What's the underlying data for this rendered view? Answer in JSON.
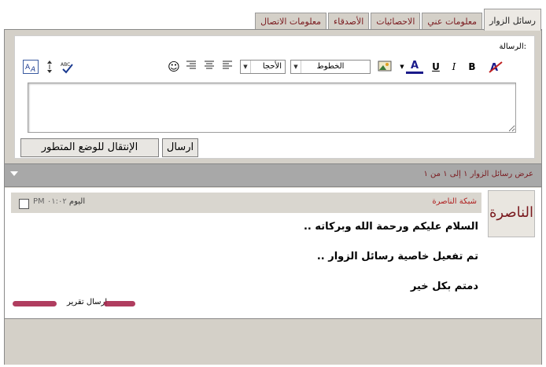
{
  "tabs": [
    {
      "label": "رسائل الزوار",
      "active": true
    },
    {
      "label": "معلومات عني",
      "active": false
    },
    {
      "label": "الاحصائيات",
      "active": false
    },
    {
      "label": "الأصدقاء",
      "active": false
    },
    {
      "label": "معلومات الاتصال",
      "active": false
    }
  ],
  "form": {
    "message_label": "الرسالة:",
    "editor_value": "",
    "toolbar": {
      "remove_format_icon": "remove-format-icon",
      "bold": "B",
      "italic": "I",
      "underline": "U",
      "font_color_letter": "A",
      "font_color": "#1a1a8a",
      "font_family_value": "الخطوط",
      "font_size_value": "الأحجا",
      "smiley": "☺"
    },
    "send_button": "ارسال",
    "advanced_button": "الإنتقال للوضع المتطور"
  },
  "list_header": {
    "text": "عرض رسائل الزوار ١ إلى ١ من ١"
  },
  "entry": {
    "author": "شبكة الناصرة",
    "avatar_text": "الناصرة",
    "date": "اليوم",
    "time": "٠١:٠٢ PM",
    "lines": [
      "السلام عليكم ورحمة الله وبركاته ..",
      "تم تفعيل خاصية رسائل الزوار ..",
      "دمتم بكل خير"
    ],
    "report_link": "إرسال تقرير"
  },
  "colors": {
    "accent": "#7a1a1f",
    "author_red": "#b02020",
    "panel_bg": "#d4d0c8",
    "header_bg": "#a8a8a8"
  }
}
